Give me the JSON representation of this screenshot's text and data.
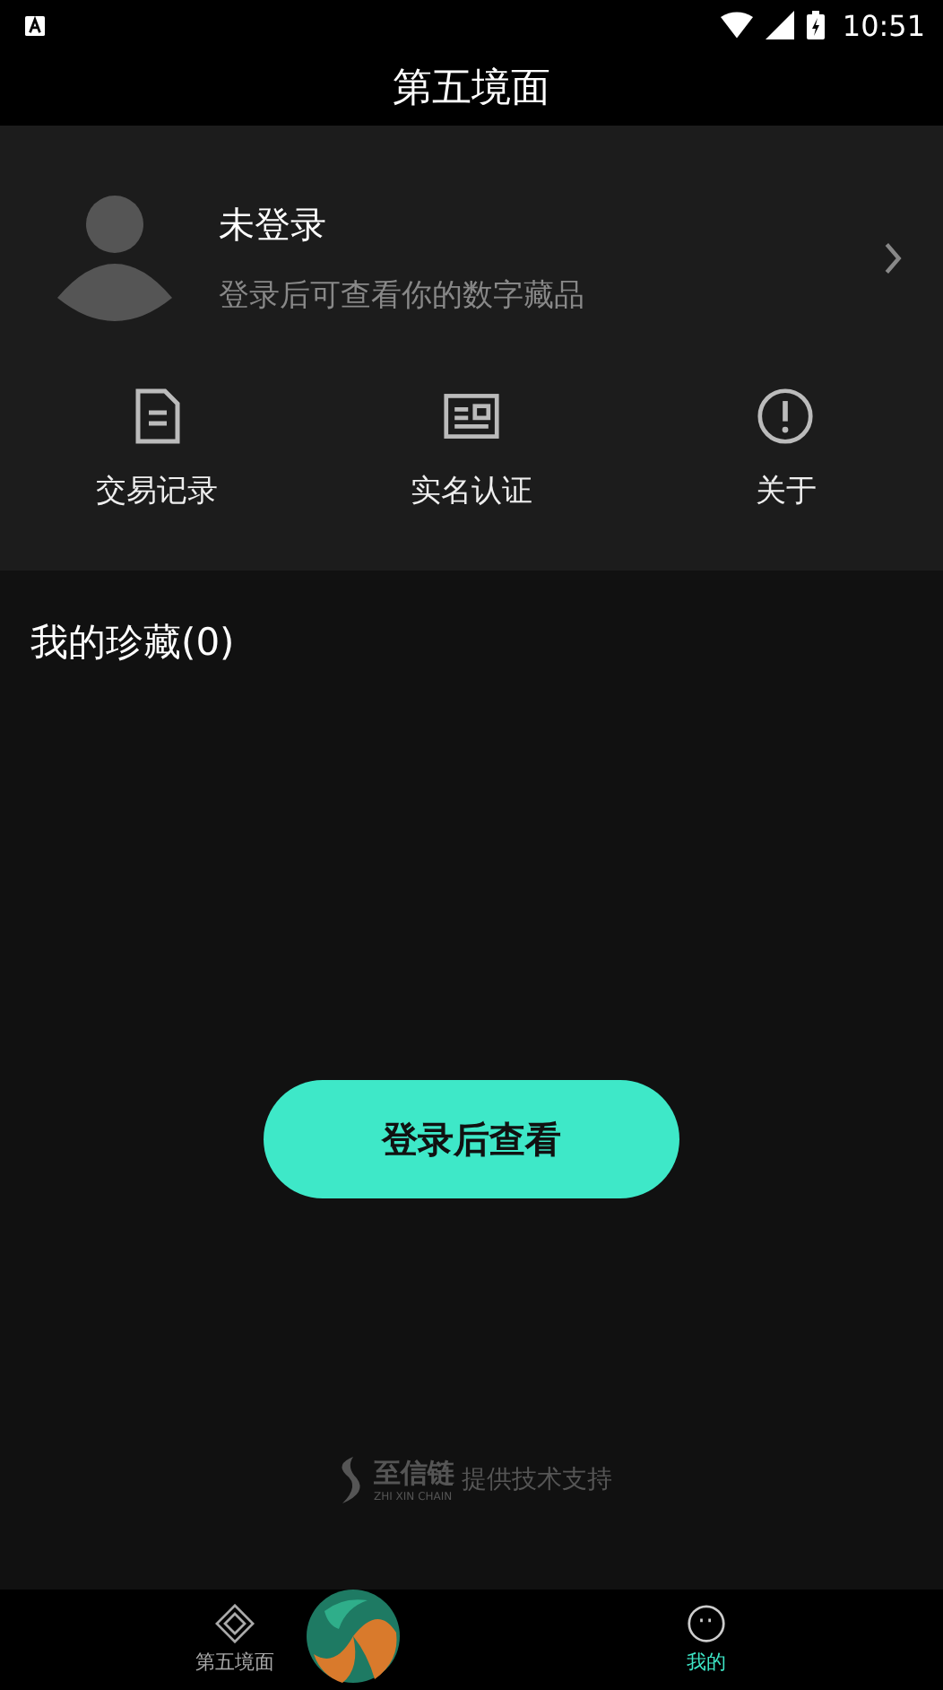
{
  "status_bar": {
    "time": "10:51"
  },
  "title": "第五境面",
  "profile": {
    "name": "未登录",
    "hint": "登录后可查看你的数字藏品"
  },
  "shortcuts": [
    {
      "label": "交易记录",
      "kind": "document"
    },
    {
      "label": "实名认证",
      "kind": "idcard"
    },
    {
      "label": "关于",
      "kind": "info"
    }
  ],
  "collection": {
    "heading": "我的珍藏(0)"
  },
  "login_button": "登录后查看",
  "footer": {
    "brand": "至信链",
    "brand_sub": "ZHI XIN CHAIN",
    "text": "提供技术支持"
  },
  "nav": [
    {
      "label": "第五境面",
      "kind": "diamond",
      "selected": false
    },
    {
      "label": "我的",
      "kind": "face",
      "selected": true
    }
  ]
}
